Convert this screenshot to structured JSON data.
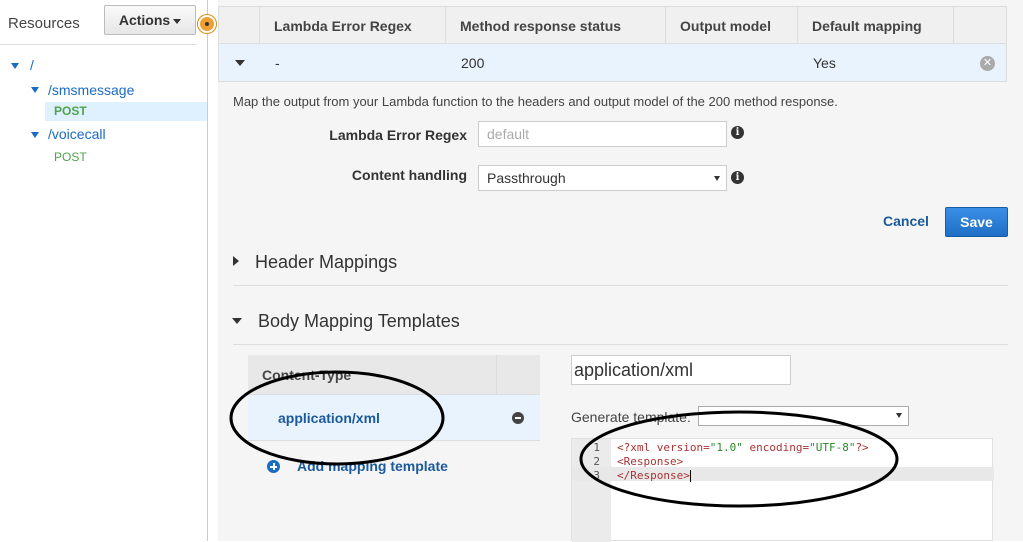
{
  "sidebar": {
    "title": "Resources",
    "actions_label": "Actions",
    "tree": [
      {
        "label": "/"
      },
      {
        "label": "/smsmessage",
        "method": "POST"
      },
      {
        "label": "/voicecall",
        "method": "POST"
      }
    ]
  },
  "table": {
    "headers": [
      "Lambda Error Regex",
      "Method response status",
      "Output model",
      "Default mapping"
    ],
    "row": {
      "regex": "-",
      "status": "200",
      "model": "",
      "default": "Yes"
    }
  },
  "form": {
    "description": "Map the output from your Lambda function to the headers and output model of the 200 method response.",
    "regex_label": "Lambda Error Regex",
    "regex_placeholder": "default",
    "content_label": "Content handling",
    "content_value": "Passthrough",
    "cancel_label": "Cancel",
    "save_label": "Save"
  },
  "sections": {
    "header_mappings": "Header Mappings",
    "body_templates": "Body Mapping Templates"
  },
  "body": {
    "content_type_header": "Content-Type",
    "content_type_item": "application/xml",
    "add_label": "Add mapping template",
    "content_type_input": "application/xml",
    "generate_label": "Generate template:",
    "generate_value": ""
  },
  "editor": {
    "lines": [
      "1",
      "2",
      "3"
    ],
    "code": {
      "l1_a": "<?xml version=",
      "l1_b": "\"1.0\"",
      "l1_c": " encoding=",
      "l1_d": "\"UTF-8\"",
      "l1_e": "?>",
      "l2": "<Response>",
      "l3": "</Response>"
    }
  },
  "colors": {
    "link": "#1a5a9c",
    "save": "#2a7ed6",
    "method": "#4fa34f",
    "accent_dot": "#f0a030"
  }
}
